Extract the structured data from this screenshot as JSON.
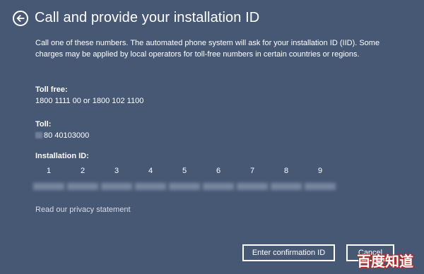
{
  "header": {
    "back_icon": "arrow-left-icon",
    "title": "Call and provide your installation ID"
  },
  "description": "Call one of these numbers. The automated phone system will ask for your installation ID (IID). Some charges may be applied by local operators for toll-free numbers in certain countries or regions.",
  "toll_free": {
    "label": "Toll free:",
    "value": "1800 1111 00 or 1800 102 1100"
  },
  "toll": {
    "label": "Toll:",
    "value": "80 40103000"
  },
  "installation_id": {
    "label": "Installation ID:",
    "group_numbers": [
      "1",
      "2",
      "3",
      "4",
      "5",
      "6",
      "7",
      "8",
      "9"
    ]
  },
  "privacy_link": "Read our privacy statement",
  "buttons": {
    "confirm": "Enter confirmation ID",
    "cancel": "Cancel"
  },
  "watermark": "百度知道"
}
